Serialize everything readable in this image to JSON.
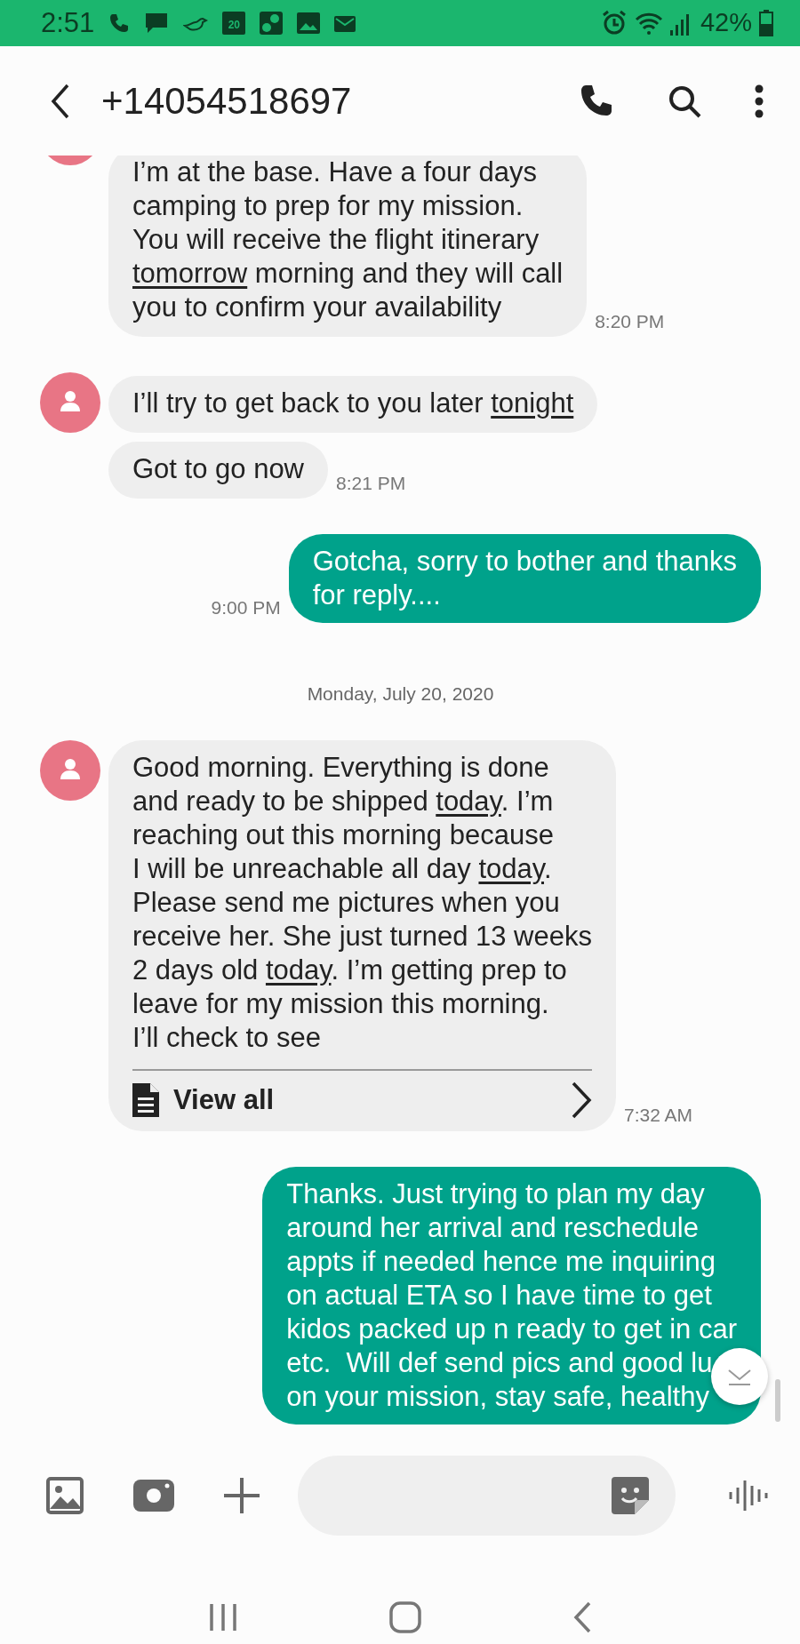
{
  "status_bar": {
    "time": "2:51",
    "calendar_day": "20",
    "battery": "42%"
  },
  "header": {
    "contact": "+14054518697"
  },
  "messages": [
    {
      "kind": "incoming",
      "avatar": true,
      "parts": [
        {
          "text": "I’m at the base. Have a four days\ncamping to prep for my mission.\nYou will receive the flight itinerary\n"
        },
        {
          "text": "tomorrow",
          "underlined": true
        },
        {
          "text": " morning and they will call\nyou to confirm your availability"
        }
      ],
      "time": "8:20 PM"
    },
    {
      "kind": "incoming",
      "avatar": true,
      "parts": [
        {
          "text": "I’ll try to get back to you later "
        },
        {
          "text": "tonight",
          "underlined": true
        }
      ]
    },
    {
      "kind": "incoming",
      "avatar": false,
      "parts": [
        {
          "text": "Got to go now"
        }
      ],
      "time": "8:21 PM"
    },
    {
      "kind": "outgoing",
      "parts": [
        {
          "text": "Gotcha, sorry to bother and thanks\nfor reply...."
        }
      ],
      "time": "9:00 PM"
    },
    {
      "kind": "date",
      "text": "Monday, July 20, 2020"
    },
    {
      "kind": "incoming",
      "avatar": true,
      "parts": [
        {
          "text": "Good morning. Everything is done\nand ready to be shipped "
        },
        {
          "text": "today",
          "underlined": true
        },
        {
          "text": ". I’m\nreaching out this morning because\nI will be unreachable all day "
        },
        {
          "text": "today",
          "underlined": true
        },
        {
          "text": ".\nPlease send me pictures when you\nreceive her. She just turned 13 weeks\n2 days old "
        },
        {
          "text": "today",
          "underlined": true
        },
        {
          "text": ". I’m getting prep to\nleave for my mission this morning.\nI’ll check to see"
        }
      ],
      "view_all": "View all",
      "time": "7:32 AM"
    },
    {
      "kind": "outgoing",
      "parts": [
        {
          "text": "Thanks. Just trying to plan my day\naround her arrival and reschedule\nappts if needed hence me inquiring\non actual ETA so I have time to get\nkidos packed up n ready to get in car\netc.  Will def send pics and good lu\non your mission, stay safe, healthy"
        }
      ]
    }
  ]
}
